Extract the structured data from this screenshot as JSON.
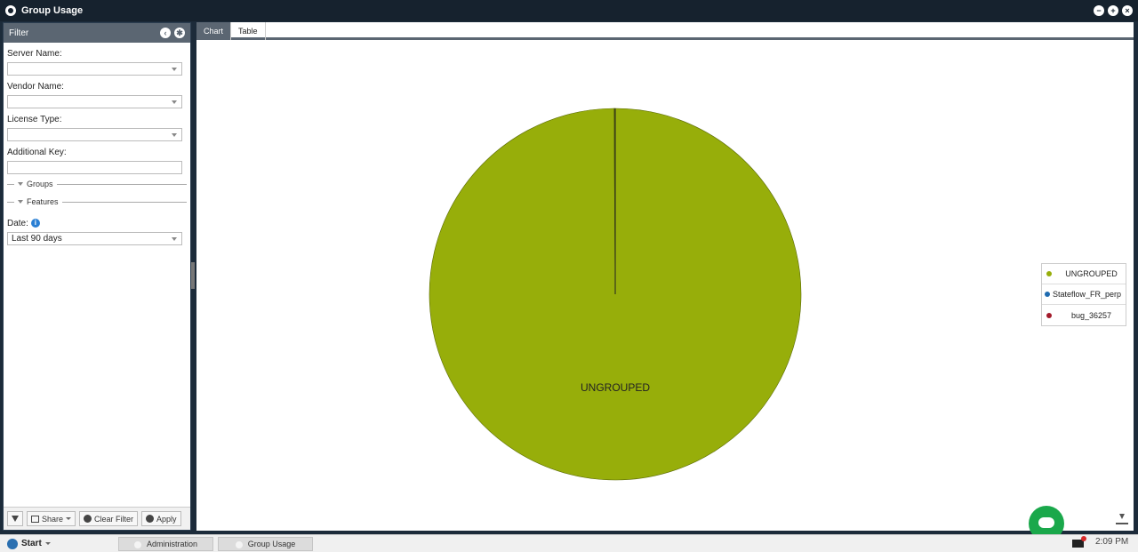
{
  "window": {
    "title": "Group Usage"
  },
  "filter": {
    "header": "Filter",
    "fields": [
      {
        "label": "Server Name:",
        "value": ""
      },
      {
        "label": "Vendor Name:",
        "value": ""
      },
      {
        "label": "License Type:",
        "value": ""
      },
      {
        "label": "Additional Key:",
        "value": ""
      }
    ],
    "groups_label": "Groups",
    "features_label": "Features",
    "date_label": "Date:",
    "date_value": "Last 90 days",
    "footer": {
      "share_label": "Share",
      "clear_label": "Clear Filter",
      "apply_label": "Apply"
    }
  },
  "tabs": [
    {
      "label": "Chart",
      "active": true
    },
    {
      "label": "Table",
      "active": false
    }
  ],
  "chart_data": {
    "type": "pie",
    "series": [
      {
        "name": "UNGROUPED",
        "value": 99.9,
        "color": "#97ae0a"
      },
      {
        "name": "Stateflow_FR_perp",
        "value": 0.05,
        "color": "#1f6bb0"
      },
      {
        "name": "bug_36257",
        "value": 0.05,
        "color": "#a31a2a"
      }
    ],
    "slice_label": "UNGROUPED",
    "legend_position": "right"
  },
  "taskbar": {
    "start_label": "Start",
    "items": [
      {
        "label": "Administration"
      },
      {
        "label": "Group Usage"
      }
    ],
    "time": "2:09 PM"
  }
}
